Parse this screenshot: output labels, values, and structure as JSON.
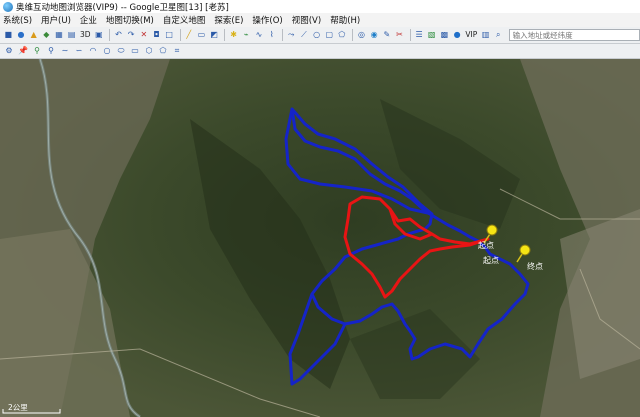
{
  "window": {
    "title": "奥维互动地图浏览器(VIP9) -- Google卫星图[13] [老苏]"
  },
  "menu": [
    {
      "name": "menu-system",
      "label": "系统(S)"
    },
    {
      "name": "menu-user",
      "label": "用户(U)"
    },
    {
      "name": "menu-enterprise",
      "label": "企业"
    },
    {
      "name": "menu-map-switch",
      "label": "地图切换(M)"
    },
    {
      "name": "menu-custom-map",
      "label": "自定义地图"
    },
    {
      "name": "menu-explore",
      "label": "探索(E)"
    },
    {
      "name": "menu-operation",
      "label": "操作(O)"
    },
    {
      "name": "menu-view",
      "label": "视图(V)"
    },
    {
      "name": "menu-help",
      "label": "帮助(H)"
    }
  ],
  "toolbar": {
    "three_d_label": "3D",
    "vip_label": "VIP",
    "search_placeholder": "输入地址或经纬度"
  },
  "map": {
    "start_label": "起点",
    "end_label": "终点",
    "scale_label": "2公里",
    "colors": {
      "route_outer": "#1524c8",
      "route_inner": "#e81414",
      "pin": "#f5e414"
    }
  }
}
